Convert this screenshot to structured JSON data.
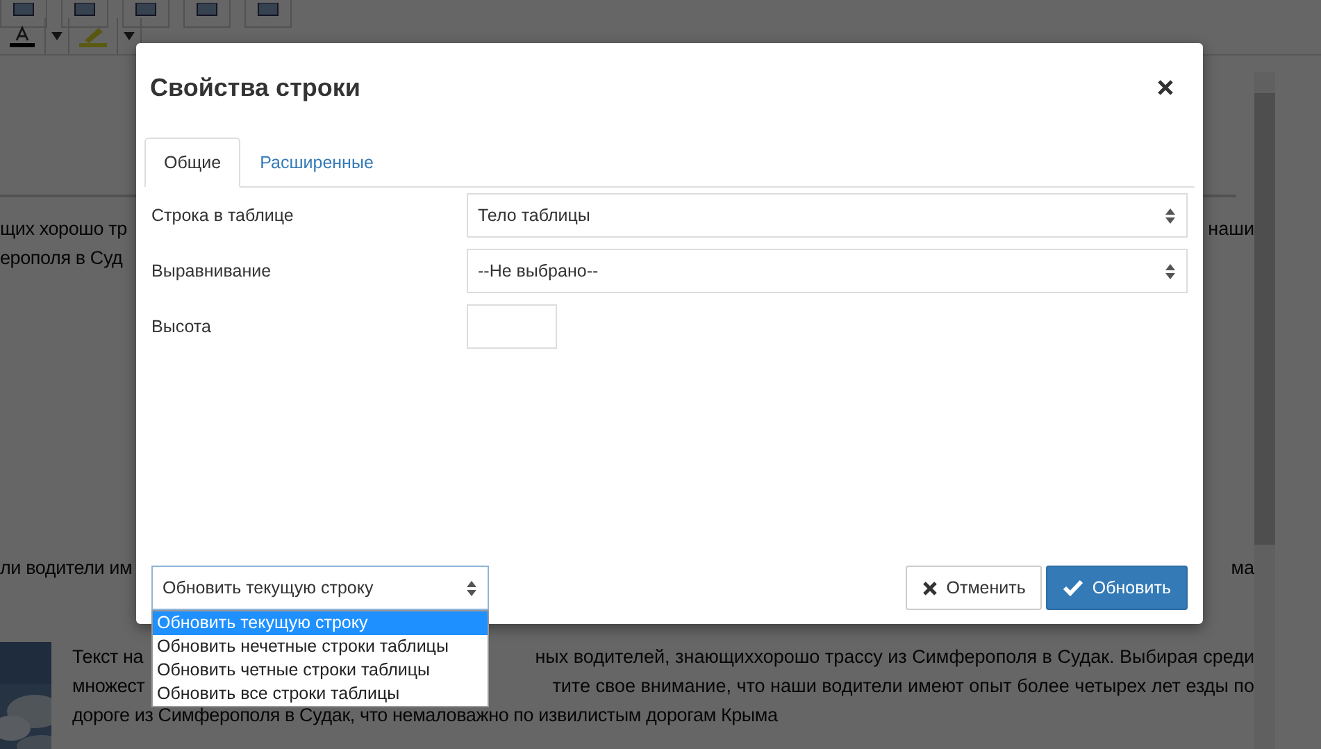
{
  "editor": {
    "lines_top": [
      {
        "left": "щих хорошо тр",
        "right": "наши"
      },
      {
        "left": "ерополя в Суд"
      }
    ],
    "line_mid": {
      "left": "ли водители им",
      "right": "ма"
    },
    "paragraph": [
      {
        "left": "Текст на",
        "right": "ных водителей, знающиххорошо трассу из Симферополя в Судак. Выбирая среди"
      },
      {
        "left": "множест",
        "right": "тите свое внимание, что наши водители имеют опыт более четырех лет езды по"
      },
      {
        "left": "дороге из Симферополя в Судак, что немаловажно по извилистым дорогам Крыма"
      }
    ]
  },
  "dialog": {
    "title": "Свойства строки",
    "tabs": [
      {
        "label": "Общие",
        "selected": true
      },
      {
        "label": "Расширенные",
        "selected": false
      }
    ],
    "fields": [
      {
        "label": "Строка в таблице",
        "kind": "select",
        "value": "Тело таблицы"
      },
      {
        "label": "Выравнивание",
        "kind": "select",
        "value": "--Не выбрано--"
      },
      {
        "label": "Высота",
        "kind": "input"
      }
    ],
    "apply_select": {
      "value": "Обновить текущую строку",
      "expanded": true,
      "options": [
        {
          "label": "Обновить текущую строку",
          "selected": true
        },
        {
          "label": "Обновить нечетные строки таблицы",
          "selected": false
        },
        {
          "label": "Обновить четные строки таблицы",
          "selected": false
        },
        {
          "label": "Обновить все строки таблицы",
          "selected": false
        }
      ]
    },
    "buttons": [
      {
        "label": "Отменить",
        "kind": "cancel"
      },
      {
        "label": "Обновить",
        "kind": "primary"
      }
    ]
  }
}
